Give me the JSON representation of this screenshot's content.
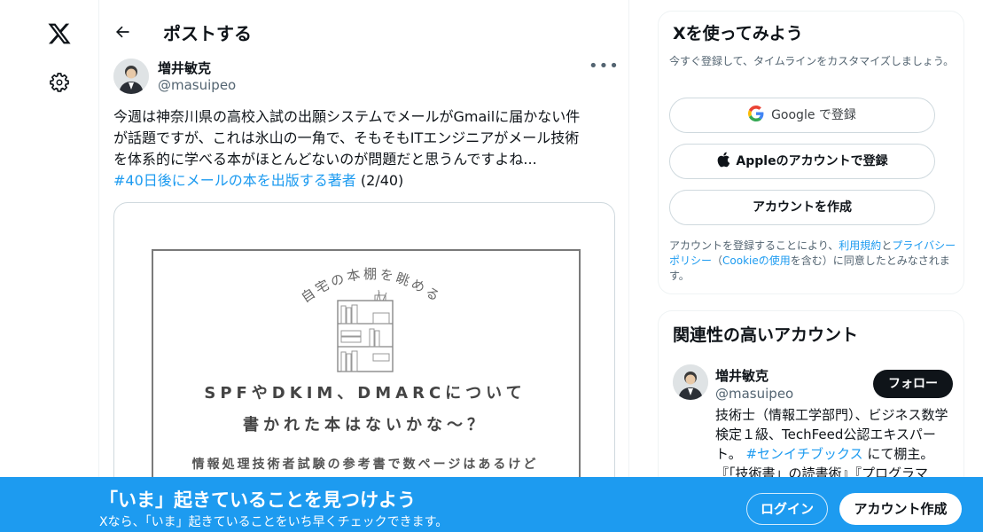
{
  "nav": {
    "logo_icon": "x-logo-icon",
    "settings_icon": "gear-icon"
  },
  "header": {
    "title": "ポストする",
    "back_icon": "arrow-left-icon"
  },
  "post": {
    "author_name": "増井敏克",
    "author_handle": "@masuipeo",
    "more_icon": "ellipsis-icon",
    "text_line1": "今週は神奈川県の高校入試の出願システムでメールがGmailに届かない件",
    "text_line2": "が話題ですが、これは氷山の一角で、そもそもITエンジニアがメール技術",
    "text_line3": "を体系的に学べる本がほとんどないのが問題だと思うんですよね...",
    "hashtag": "#40日後にメールの本を出版する著者",
    "counter": "(2/40)",
    "media": {
      "arc_text": "自宅の本棚を眺める",
      "line1": "SPFやDKIM、DMARCについて",
      "line2": "書かれた本はないかな～？",
      "line3": "情報処理技術者試験の参考書で数ページはあるけど"
    }
  },
  "signup": {
    "title": "Xを使ってみよう",
    "subtitle": "今すぐ登録して、タイムラインをカスタマイズしましょう。",
    "google_label": "Google で登録",
    "apple_label": "Appleのアカウントで登録",
    "create_label": "アカウントを作成",
    "terms_1": "アカウントを登録することにより、",
    "terms_link1": "利用規約",
    "terms_2": "と",
    "terms_link2": "プライバシーポリシー",
    "terms_3": "（",
    "terms_link3": "Cookieの使用",
    "terms_4": "を含む）に同意したとみなされます。"
  },
  "related": {
    "title": "関連性の高いアカウント",
    "name": "増井敏克",
    "handle": "@masuipeo",
    "follow_label": "フォロー",
    "bio_1": "技術士（情報工学部門）、ビジネス数学検定１級、TechFeed公認エキスパート。",
    "bio_hashtag": "#センイチブックス",
    "bio_2": "にて棚主。『「技術書」の読書術』『プログラマ"
  },
  "banner": {
    "title": "「いま」起きていることを見つけよう",
    "subtitle": "Xなら、「いま」起きていることをいち早くチェックできます。",
    "login_label": "ログイン",
    "signup_label": "アカウント作成"
  },
  "colors": {
    "accent": "#1d9bf0",
    "text": "#0f1419",
    "muted": "#536471"
  }
}
